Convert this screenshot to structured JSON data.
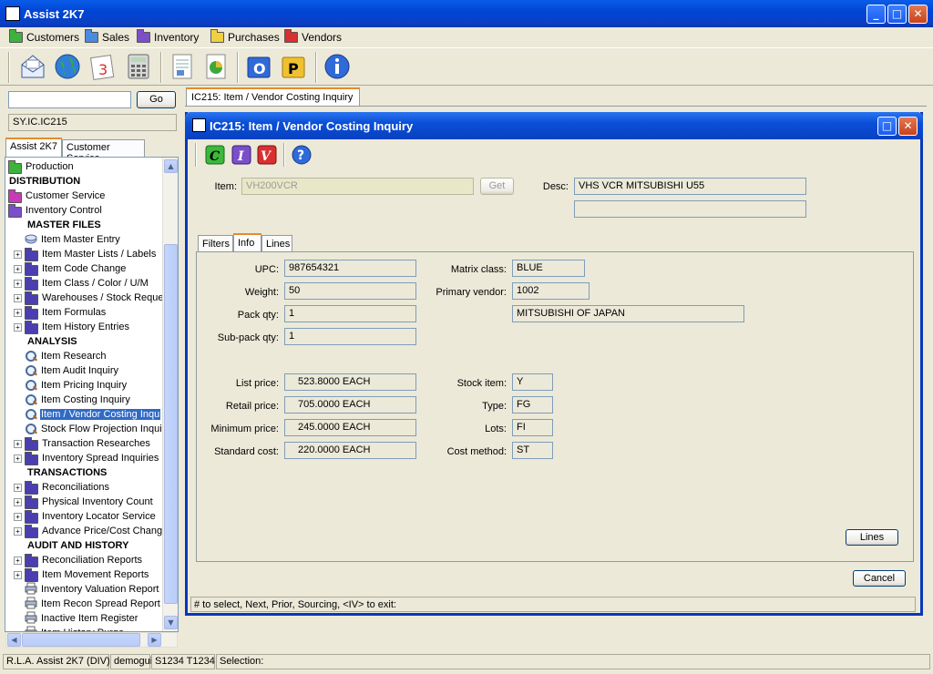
{
  "window": {
    "title": "Assist 2K7"
  },
  "menu": [
    {
      "label": "Customers",
      "color": "#3db23d"
    },
    {
      "label": "Sales",
      "color": "#4a8ae0"
    },
    {
      "label": "Inventory",
      "color": "#7b4fc8"
    },
    {
      "label": "Purchases",
      "color": "#f0d040"
    },
    {
      "label": "Vendors",
      "color": "#d83030"
    }
  ],
  "toolbar_icons": [
    "mail-icon",
    "globe-icon",
    "calendar-icon",
    "calculator-icon",
    "report-icon",
    "spreadsheet-icon",
    "outlook-icon",
    "publisher-icon",
    "info-icon"
  ],
  "left": {
    "search_value": "",
    "go_label": "Go",
    "program_code": "SY.IC.IC215",
    "tabs": [
      "Assist 2K7",
      "Customer Service"
    ],
    "tree": [
      {
        "label": "Production",
        "kind": "folder",
        "indent": 0,
        "color": "#3db23d"
      },
      {
        "label": "DISTRIBUTION",
        "kind": "header",
        "indent": 0
      },
      {
        "label": "Customer Service",
        "kind": "folder",
        "indent": 0,
        "color": "#c83ab8"
      },
      {
        "label": "Inventory Control",
        "kind": "folder",
        "indent": 0,
        "color": "#7b4fc8"
      },
      {
        "label": "MASTER FILES",
        "kind": "header",
        "indent": 1
      },
      {
        "label": "Item Master Entry",
        "kind": "program",
        "indent": 1
      },
      {
        "label": "Item Master Lists / Labels",
        "kind": "folder",
        "indent": 1,
        "color": "#4b3fb0",
        "expand": true
      },
      {
        "label": "Item Code Change",
        "kind": "folder",
        "indent": 1,
        "color": "#4b3fb0",
        "expand": true
      },
      {
        "label": "Item Class / Color / U/M",
        "kind": "folder",
        "indent": 1,
        "color": "#4b3fb0",
        "expand": true
      },
      {
        "label": "Warehouses / Stock Reque",
        "kind": "folder",
        "indent": 1,
        "color": "#4b3fb0",
        "expand": true
      },
      {
        "label": "Item Formulas",
        "kind": "folder",
        "indent": 1,
        "color": "#4b3fb0",
        "expand": true
      },
      {
        "label": "Item History Entries",
        "kind": "folder",
        "indent": 1,
        "color": "#4b3fb0",
        "expand": true
      },
      {
        "label": "ANALYSIS",
        "kind": "header",
        "indent": 1
      },
      {
        "label": "Item Research",
        "kind": "mag",
        "indent": 1
      },
      {
        "label": "Item Audit Inquiry",
        "kind": "mag",
        "indent": 1
      },
      {
        "label": "Item Pricing Inquiry",
        "kind": "mag",
        "indent": 1
      },
      {
        "label": "Item Costing Inquiry",
        "kind": "mag",
        "indent": 1
      },
      {
        "label": "Item / Vendor Costing Inqu",
        "kind": "mag",
        "indent": 1,
        "selected": true
      },
      {
        "label": "Stock Flow Projection Inqui",
        "kind": "mag",
        "indent": 1
      },
      {
        "label": "Transaction Researches",
        "kind": "folder",
        "indent": 1,
        "color": "#4b3fb0",
        "expand": true
      },
      {
        "label": "Inventory Spread Inquiries",
        "kind": "folder",
        "indent": 1,
        "color": "#4b3fb0",
        "expand": true
      },
      {
        "label": "TRANSACTIONS",
        "kind": "header",
        "indent": 1
      },
      {
        "label": "Reconciliations",
        "kind": "folder",
        "indent": 1,
        "color": "#4b3fb0",
        "expand": true
      },
      {
        "label": "Physical Inventory Count",
        "kind": "folder",
        "indent": 1,
        "color": "#4b3fb0",
        "expand": true
      },
      {
        "label": "Inventory Locator Service",
        "kind": "folder",
        "indent": 1,
        "color": "#4b3fb0",
        "expand": true
      },
      {
        "label": "Advance Price/Cost Chang",
        "kind": "folder",
        "indent": 1,
        "color": "#4b3fb0",
        "expand": true
      },
      {
        "label": "AUDIT AND HISTORY",
        "kind": "header",
        "indent": 1
      },
      {
        "label": "Reconciliation Reports",
        "kind": "folder",
        "indent": 1,
        "color": "#4b3fb0",
        "expand": true
      },
      {
        "label": "Item Movement Reports",
        "kind": "folder",
        "indent": 1,
        "color": "#4b3fb0",
        "expand": true
      },
      {
        "label": "Inventory Valuation Report",
        "kind": "printer",
        "indent": 1
      },
      {
        "label": "Item Recon Spread Report",
        "kind": "printer",
        "indent": 1
      },
      {
        "label": "Inactive Item Register",
        "kind": "printer",
        "indent": 1
      },
      {
        "label": "Item History Purge",
        "kind": "printer",
        "indent": 1
      }
    ]
  },
  "doc_tab": "IC215: Item / Vendor Costing Inquiry",
  "inner": {
    "title": "IC215: Item / Vendor Costing Inquiry",
    "item_label": "Item:",
    "item_value": "VH200VCR",
    "get_label": "Get",
    "desc_label": "Desc:",
    "desc_value": "VHS VCR MITSUBISHI U55",
    "desc2_value": "",
    "tabs": [
      "Filters",
      "Info",
      "Lines"
    ],
    "info": {
      "upc_label": "UPC:",
      "upc": "987654321",
      "weight_label": "Weight:",
      "weight": "50",
      "pack_label": "Pack qty:",
      "pack": "1",
      "subpack_label": "Sub-pack qty:",
      "subpack": "1",
      "matrix_label": "Matrix class:",
      "matrix": "BLUE",
      "vendor_label": "Primary vendor:",
      "vendor": "1002",
      "vendor_name": "MITSUBISHI OF JAPAN",
      "list_label": "List price:",
      "list": "523.8000 EACH",
      "retail_label": "Retail price:",
      "retail": "705.0000 EACH",
      "min_label": "Minimum price:",
      "min": "245.0000 EACH",
      "std_label": "Standard cost:",
      "std": "220.0000 EACH",
      "stock_label": "Stock item:",
      "stock": "Y",
      "type_label": "Type:",
      "type": "FG",
      "lots_label": "Lots:",
      "lots": "FI",
      "cost_label": "Cost method:",
      "cost": "ST"
    },
    "lines_button": "Lines",
    "cancel_button": "Cancel",
    "status_text": "# to select,  Next,  Prior,  Sourcing,  <IV> to exit:"
  },
  "statusbar": [
    "R.L.A. Assist 2K7 (DIV)",
    "demogui",
    "S1234 T1234",
    "Selection:"
  ]
}
